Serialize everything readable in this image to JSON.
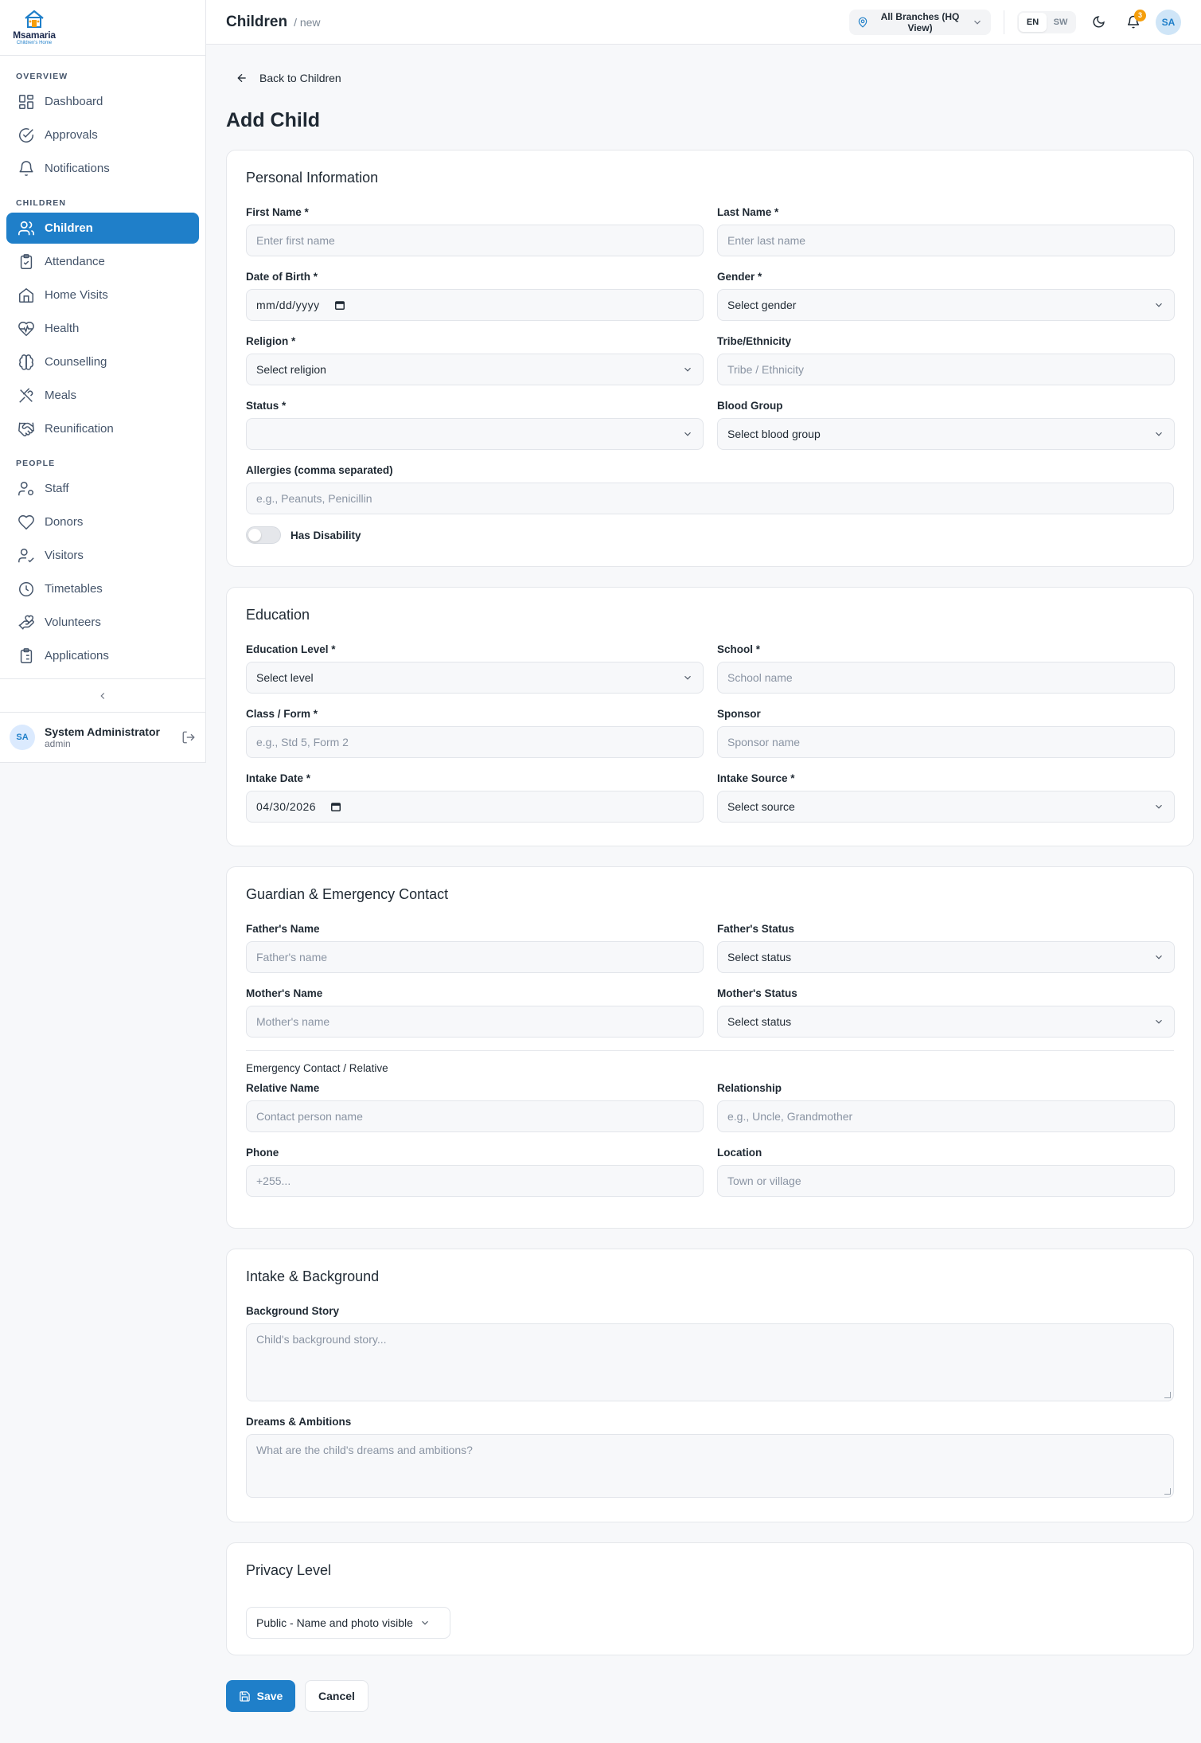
{
  "app": {
    "name": "Msamaria",
    "tagline": "Children's Home"
  },
  "sidebar": {
    "sections": [
      {
        "title": "Overview",
        "items": [
          {
            "label": "Dashboard",
            "icon": "dashboard-icon"
          },
          {
            "label": "Approvals",
            "icon": "check-circle-icon"
          },
          {
            "label": "Notifications",
            "icon": "bell-icon"
          }
        ]
      },
      {
        "title": "Children",
        "items": [
          {
            "label": "Children",
            "icon": "users-icon",
            "active": true
          },
          {
            "label": "Attendance",
            "icon": "clipboard-check-icon"
          },
          {
            "label": "Home Visits",
            "icon": "home-icon"
          },
          {
            "label": "Health",
            "icon": "heart-pulse-icon"
          },
          {
            "label": "Counselling",
            "icon": "brain-icon"
          },
          {
            "label": "Meals",
            "icon": "utensils-icon"
          },
          {
            "label": "Reunification",
            "icon": "handshake-icon"
          }
        ]
      },
      {
        "title": "People",
        "items": [
          {
            "label": "Staff",
            "icon": "user-cog-icon"
          },
          {
            "label": "Donors",
            "icon": "heart-icon"
          },
          {
            "label": "Visitors",
            "icon": "user-check-icon"
          },
          {
            "label": "Timetables",
            "icon": "clock-icon"
          },
          {
            "label": "Volunteers",
            "icon": "hand-heart-icon"
          },
          {
            "label": "Applications",
            "icon": "clipboard-list-icon"
          }
        ]
      }
    ],
    "user": {
      "initials": "SA",
      "name": "System Administrator",
      "role": "admin"
    }
  },
  "topbar": {
    "title": "Children",
    "sub": "/ new",
    "branch": "All Branches (HQ View)",
    "lang": [
      "EN",
      "SW"
    ],
    "notifications_count": "3",
    "avatar": "SA"
  },
  "page": {
    "back": "Back to Children",
    "title": "Add Child"
  },
  "personal": {
    "title": "Personal Information",
    "first_name": {
      "label": "First Name *",
      "placeholder": "Enter first name"
    },
    "last_name": {
      "label": "Last Name *",
      "placeholder": "Enter last name"
    },
    "dob": {
      "label": "Date of Birth *",
      "value": "mm/dd/yyyy"
    },
    "gender": {
      "label": "Gender *",
      "value": "Select gender"
    },
    "religion": {
      "label": "Religion *",
      "value": "Select religion"
    },
    "tribe": {
      "label": "Tribe/Ethnicity",
      "placeholder": "Tribe / Ethnicity"
    },
    "status": {
      "label": "Status *",
      "value": ""
    },
    "blood": {
      "label": "Blood Group",
      "value": "Select blood group"
    },
    "allergies": {
      "label": "Allergies (comma separated)",
      "placeholder": "e.g., Peanuts, Penicillin"
    },
    "disability": {
      "label": "Has Disability"
    }
  },
  "education": {
    "title": "Education",
    "level": {
      "label": "Education Level *",
      "value": "Select level"
    },
    "school": {
      "label": "School *",
      "placeholder": "School name"
    },
    "class": {
      "label": "Class / Form *",
      "placeholder": "e.g., Std 5, Form 2"
    },
    "sponsor": {
      "label": "Sponsor",
      "placeholder": "Sponsor name"
    },
    "intake_date": {
      "label": "Intake Date *",
      "value": "04/30/2026"
    },
    "intake_source": {
      "label": "Intake Source *",
      "value": "Select source"
    }
  },
  "guardian": {
    "title": "Guardian & Emergency Contact",
    "father_name": {
      "label": "Father's Name",
      "placeholder": "Father's name"
    },
    "father_status": {
      "label": "Father's Status",
      "value": "Select status"
    },
    "mother_name": {
      "label": "Mother's Name",
      "placeholder": "Mother's name"
    },
    "mother_status": {
      "label": "Mother's Status",
      "value": "Select status"
    },
    "emergency_heading": "Emergency Contact / Relative",
    "relative_name": {
      "label": "Relative Name",
      "placeholder": "Contact person name"
    },
    "relationship": {
      "label": "Relationship",
      "placeholder": "e.g., Uncle, Grandmother"
    },
    "phone": {
      "label": "Phone",
      "placeholder": "+255..."
    },
    "location": {
      "label": "Location",
      "placeholder": "Town or village"
    }
  },
  "intake": {
    "title": "Intake & Background",
    "story": {
      "label": "Background Story",
      "placeholder": "Child's background story..."
    },
    "dreams": {
      "label": "Dreams & Ambitions",
      "placeholder": "What are the child's dreams and ambitions?"
    }
  },
  "privacy": {
    "title": "Privacy Level",
    "value": "Public - Name and photo visible"
  },
  "actions": {
    "save": "Save",
    "cancel": "Cancel"
  },
  "colors": {
    "primary": "#1f7fc9",
    "badge": "#f59e0b"
  }
}
